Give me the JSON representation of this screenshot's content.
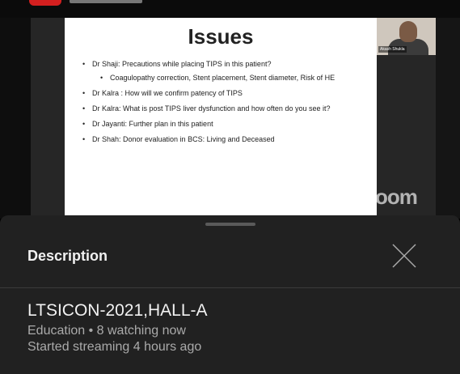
{
  "colors": {
    "panel_bg": "#212121",
    "video_bg": "#262626",
    "accent_red": "#d31f1f",
    "secondary_text": "#aaaaaa"
  },
  "video": {
    "slide": {
      "title": "Issues",
      "bullets": [
        {
          "text": "Dr  Shaji: Precautions while placing TIPS in this patient?",
          "level": 1
        },
        {
          "text": "Coagulopathy correction, Stent placement, Stent diameter, Risk of HE",
          "level": 2
        },
        {
          "text": "Dr Kalra : How will we confirm patency of TIPS",
          "level": 1
        },
        {
          "text": "Dr Kalra: What is post TIPS liver dysfunction and how often do you see it?",
          "level": 1
        },
        {
          "text": "Dr Jayanti: Further plan in this patient",
          "level": 1
        },
        {
          "text": "Dr Shah: Donor evaluation in BCS: Living and Deceased",
          "level": 1
        }
      ]
    },
    "participant_name": "Akash Shukla",
    "watermark": "zoom"
  },
  "description_panel": {
    "heading": "Description",
    "close_icon": "close-icon",
    "stream_title": "LTSICON-2021,HALL-A",
    "meta_line1": "Education • 8 watching now",
    "meta_line2": "Started streaming 4 hours ago"
  }
}
